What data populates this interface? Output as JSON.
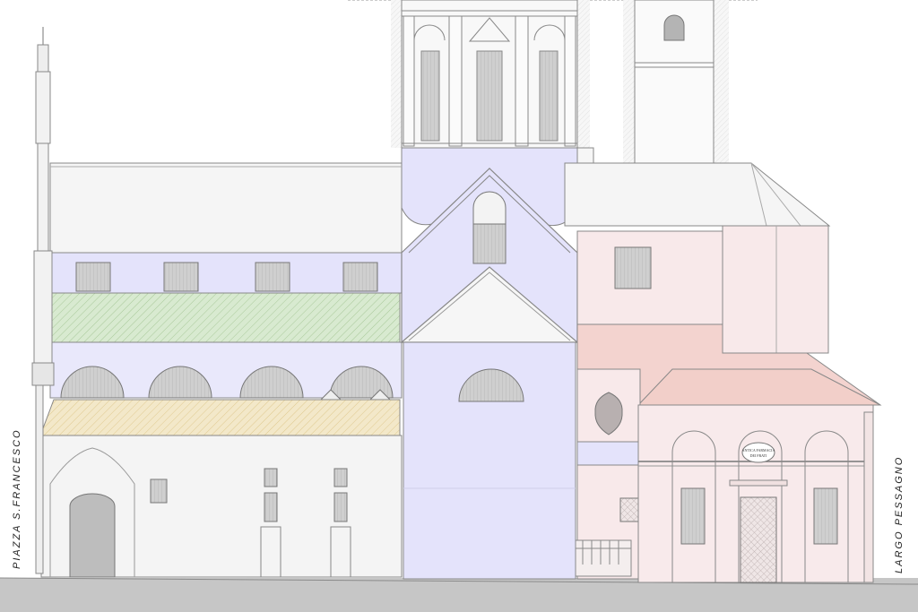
{
  "labels": {
    "left_street": "PIAZZA S.FRANCESCO",
    "right_street": "LARGO PESSAGNO",
    "plaque_line1": "ANTICA FARMACIA",
    "plaque_line2": "DEI FRATI"
  },
  "colors": {
    "lavender": "#e4e3fb",
    "pink": "#f8e9ea",
    "salmon": "#f3d3cf",
    "green": "#d8ead0",
    "yellow": "#f3e8c9",
    "roof": "#f5f5f5",
    "glass": "#c9c9c9",
    "ground": "#c6c6c6",
    "line": "#7a7a7a"
  }
}
